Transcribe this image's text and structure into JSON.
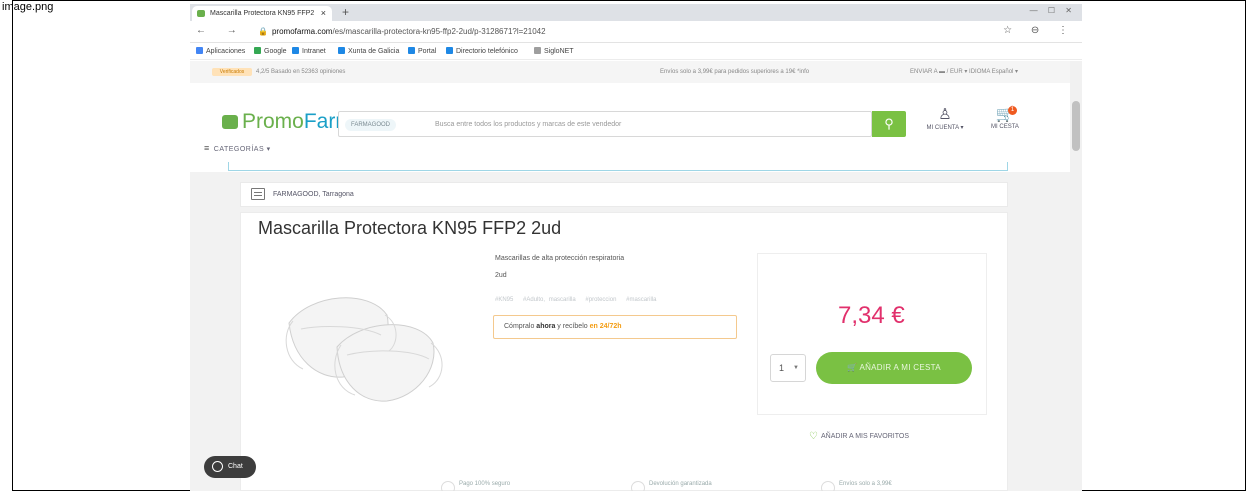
{
  "outer": {
    "label": "image.png"
  },
  "browser": {
    "tab_title": "Mascarilla Protectora KN95 FFP2",
    "tab_close": "×",
    "new_tab": "+",
    "window_controls": "— ☐ ✕",
    "nav": "← → C",
    "url_domain": "promofarma.com",
    "url_path": "/es/mascarilla-protectora-kn95-ffp2-2ud/p-3128671?l=21042",
    "addr_right": "☆ ⊖ ⋮",
    "bookmarks": [
      "Aplicaciones",
      "Google",
      "Intranet",
      "Xunta de Galicia",
      "Portal",
      "Directorio telefónico",
      "SigloNET"
    ]
  },
  "topbar": {
    "verified": "Verificados",
    "rating": "4,2/5 Basado en 52363 opiniones",
    "shipping": "Envíos solo a 3,99€ para pedidos superiores a 19€ *info",
    "locale": "ENVIAR A  ▬ / EUR ▾   IDIOMA  Español ▾"
  },
  "header": {
    "logo_a": "Promo",
    "logo_b": "Farma",
    "search_chip": "FARMAGOOD",
    "search_placeholder": "Busca entre todos los productos y marcas de este vendedor",
    "account_label": "MI CUENTA ▾",
    "cart_label": "MI CESTA",
    "cart_count": "1",
    "categories": "CATEGORÍAS ▾"
  },
  "seller": {
    "name": "FARMAGOOD, Tarragona"
  },
  "product": {
    "title": "Mascarilla Protectora KN95 FFP2 2ud",
    "description": "Mascarillas de alta protección respiratoria",
    "quantity_text": "2ud",
    "tags": [
      "#KN95",
      "#Adulto, mascarilla",
      "#proteccion",
      "#mascarilla"
    ],
    "delivery_pre": "Cómpralo ",
    "delivery_bold": "ahora",
    "delivery_mid": " y recíbelo ",
    "delivery_hl": "en 24/72h",
    "price": "7,34 €",
    "qty_value": "1",
    "add_to_cart": "AÑADIR A MI CESTA",
    "favorites": "AÑADIR A MIS FAVORITOS",
    "benefits": [
      "Pago 100% seguro",
      "Devolución garantizada",
      "Envíos solo a 3,99€"
    ]
  },
  "chat": {
    "label": "Chat"
  }
}
